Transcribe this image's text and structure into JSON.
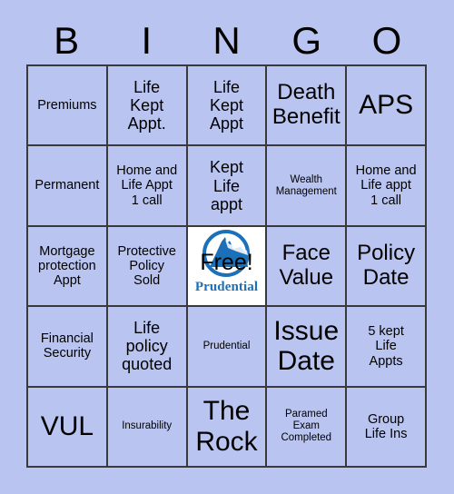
{
  "card": {
    "header_letters": [
      "B",
      "I",
      "N",
      "G",
      "O"
    ],
    "background_color": "#b9c5f0",
    "cell_background_color": "#b9c5f0",
    "border_color": "#3a3a3a",
    "text_color": "#000000",
    "brand_color": "#1b70b8"
  },
  "cells": [
    {
      "text": "Premiums",
      "size": "s-sm"
    },
    {
      "text": "Life\nKept\nAppt.",
      "size": "s-md"
    },
    {
      "text": "Life\nKept\nAppt",
      "size": "s-md"
    },
    {
      "text": "Death\nBenefit",
      "size": "s-lg"
    },
    {
      "text": "APS",
      "size": "s-xl"
    },
    {
      "text": "Permanent",
      "size": "s-sm"
    },
    {
      "text": "Home and\nLife Appt\n1 call",
      "size": "s-sm"
    },
    {
      "text": "Kept\nLife\nappt",
      "size": "s-md"
    },
    {
      "text": "Wealth\nManagement",
      "size": "s-xs"
    },
    {
      "text": "Home and\nLife appt\n1 call",
      "size": "s-sm"
    },
    {
      "text": "Mortgage\nprotection\nAppt",
      "size": "s-sm"
    },
    {
      "text": "Protective\nPolicy\nSold",
      "size": "s-sm"
    },
    {
      "text": "FREE",
      "size": "free"
    },
    {
      "text": "Face\nValue",
      "size": "s-lg"
    },
    {
      "text": "Policy\nDate",
      "size": "s-lg"
    },
    {
      "text": "Financial\nSecurity",
      "size": "s-sm"
    },
    {
      "text": "Life\npolicy\nquoted",
      "size": "s-md"
    },
    {
      "text": "Prudential",
      "size": "s-xs"
    },
    {
      "text": "Issue\nDate",
      "size": "s-xl"
    },
    {
      "text": "5 kept\nLife\nAppts",
      "size": "s-sm"
    },
    {
      "text": "VUL",
      "size": "s-xl"
    },
    {
      "text": "Insurability",
      "size": "s-xs"
    },
    {
      "text": "The\nRock",
      "size": "s-xl"
    },
    {
      "text": "Paramed\nExam\nCompleted",
      "size": "s-xs"
    },
    {
      "text": "Group\nLife Ins",
      "size": "s-sm"
    }
  ],
  "free_space": {
    "free_label": "Free!",
    "brand_name": "Prudential",
    "logo_icon": "prudential-rock-logo"
  }
}
